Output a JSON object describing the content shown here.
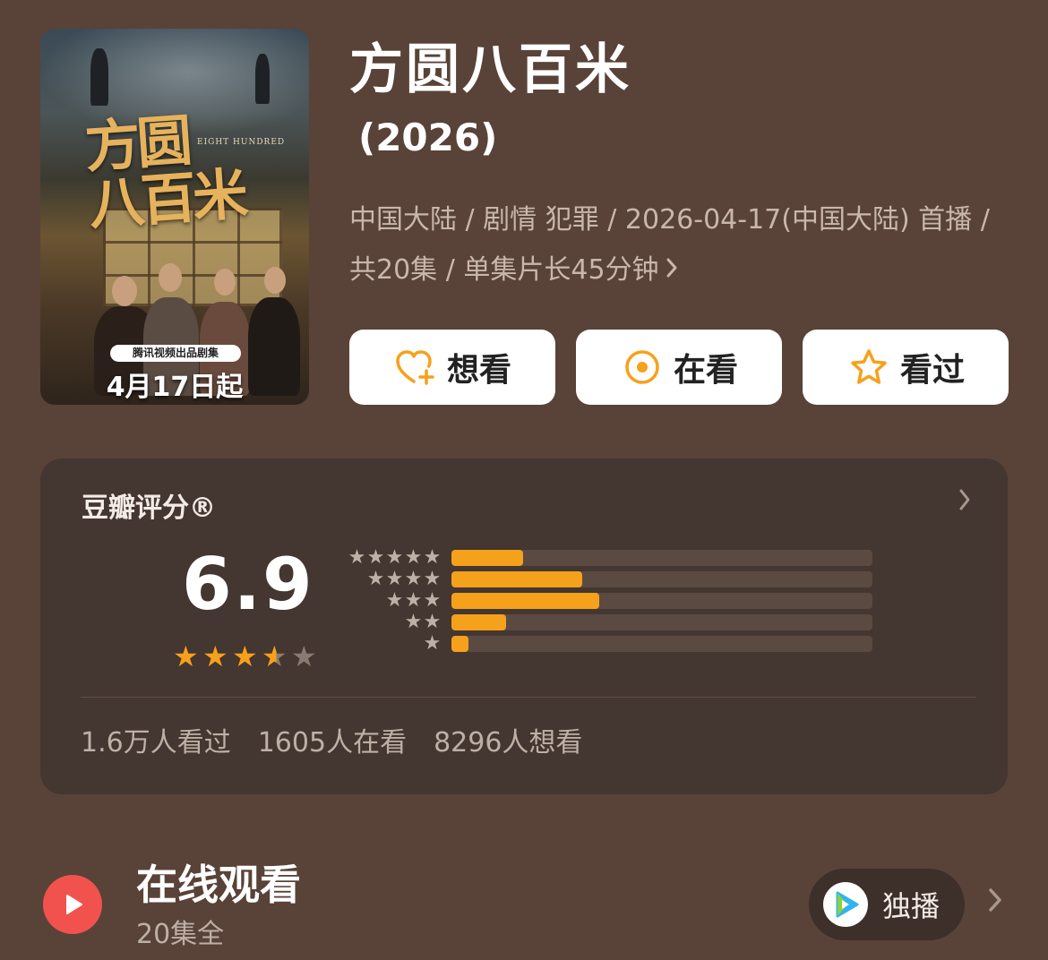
{
  "poster": {
    "title_art": "方圆\n八百米",
    "english_title": "EIGHT HUNDRED",
    "badge": "腾讯视频出品剧集",
    "release_text": "4月17日起"
  },
  "title": "方圆八百米",
  "year": "(2026)",
  "meta": {
    "line": "中国大陆 / 剧情 犯罪 / 2026-04-17(中国大陆) 首播 / 共20集 / 单集片长45分钟",
    "chevron_icon": "chevron-right-icon"
  },
  "actions": [
    {
      "label": "想看",
      "icon": "heart-plus-icon"
    },
    {
      "label": "在看",
      "icon": "target-circle-icon"
    },
    {
      "label": "看过",
      "icon": "star-outline-icon"
    }
  ],
  "rating": {
    "label": "豆瓣评分®",
    "score": "6.9",
    "average_stars": 3.5,
    "star_color": "#f6a11b",
    "distribution": [
      {
        "stars": 5,
        "fraction": 0.17
      },
      {
        "stars": 4,
        "fraction": 0.31
      },
      {
        "stars": 3,
        "fraction": 0.35
      },
      {
        "stars": 2,
        "fraction": 0.13
      },
      {
        "stars": 1,
        "fraction": 0.04
      }
    ],
    "stats": {
      "watched": "1.6万人看过",
      "watching": "1605人在看",
      "want": "8296人想看"
    }
  },
  "online": {
    "title": "在线观看",
    "subtitle": "20集全",
    "exclusive_label": "独播",
    "platform_icon": "tencent-video-icon",
    "accent": "#f2524d"
  }
}
